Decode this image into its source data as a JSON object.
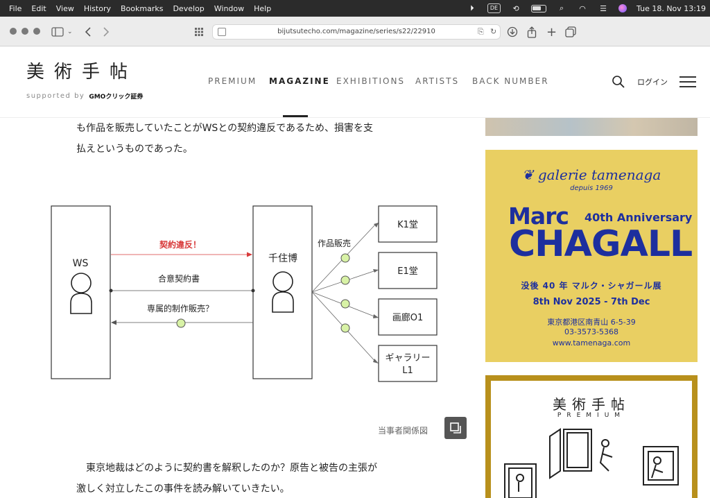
{
  "menubar": {
    "items": [
      "File",
      "Edit",
      "View",
      "History",
      "Bookmarks",
      "Develop",
      "Window",
      "Help"
    ],
    "input_source": "DE",
    "clock": "Tue 18. Nov  13:19"
  },
  "browser": {
    "url": "bijutsutecho.com/magazine/series/s22/22910"
  },
  "site": {
    "logo": "美術手帖",
    "supported_by": "supported by",
    "sponsor": "GMOクリック証券",
    "nav": [
      "PREMIUM",
      "MAGAZINE",
      "EXHIBITIONS",
      "ARTISTS",
      "BACK NUMBER"
    ],
    "active_nav": "MAGAZINE",
    "login": "ログイン"
  },
  "article": {
    "para1_line1": "も作品を販売していたことがWSとの契約違反であるため、損害を支",
    "para1_line2": "払えというものであった。",
    "caption": "当事者関係図",
    "para2_line1": "　東京地裁はどのように契約書を解釈したのか？原告と被告の主張が",
    "para2_line2": "激しく対立したこの事件を読み解いていきたい。"
  },
  "diagram": {
    "left_party": "WS",
    "right_party": "千住博",
    "breach_label": "契約違反！",
    "agreement_label": "合意契約書",
    "exclusive_label": "専属的制作販売？",
    "sales_label": "作品販売",
    "galleries": [
      "K1堂",
      "E1堂",
      "画廊O1",
      "ギャラリー",
      "L1"
    ],
    "breach_color": "#d83a3a",
    "node_color": "#d8f2a6"
  },
  "sidebar": {
    "ad1": {
      "gallery": "galerie tamenaga",
      "depuis": "depuis 1969",
      "name_first": "Marc",
      "anniversary": "40th Anniversary",
      "name_last": "CHAGALL",
      "jp_title": "没後 40 年  マルク・シャガール展",
      "dates": "8th Nov 2025 - 7th Dec",
      "address": "東京都港区南青山 6-5-39",
      "tel": "03-3573-5368",
      "web": "www.tamenaga.com",
      "bg_color": "#e9cf62",
      "text_color": "#1d2f9e"
    },
    "ad2": {
      "logo": "美術手帖",
      "premium": "PREMIUM"
    }
  }
}
